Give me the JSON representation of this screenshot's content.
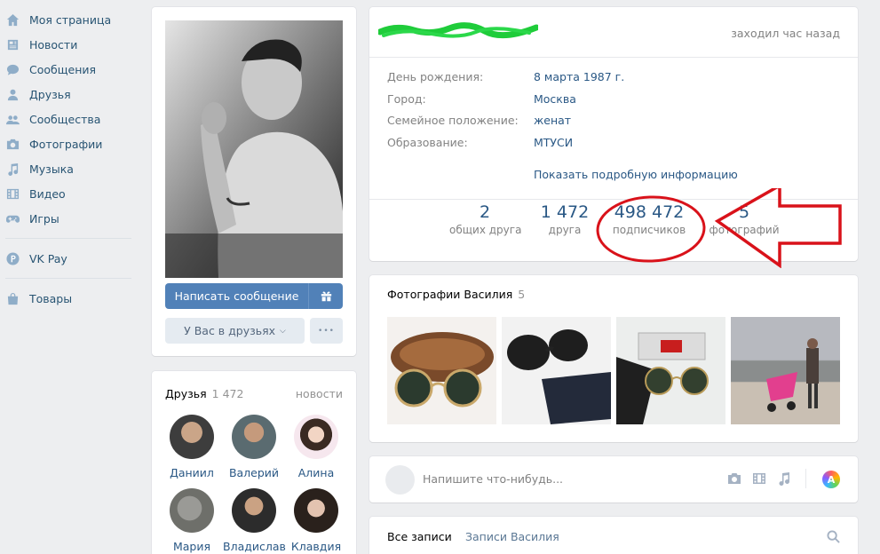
{
  "nav": {
    "items": [
      {
        "label": "Моя страница",
        "icon": "home-icon"
      },
      {
        "label": "Новости",
        "icon": "news-icon"
      },
      {
        "label": "Сообщения",
        "icon": "messages-icon"
      },
      {
        "label": "Друзья",
        "icon": "friends-icon"
      },
      {
        "label": "Сообщества",
        "icon": "communities-icon"
      },
      {
        "label": "Фотографии",
        "icon": "camera-icon"
      },
      {
        "label": "Музыка",
        "icon": "music-icon"
      },
      {
        "label": "Видео",
        "icon": "video-icon"
      },
      {
        "label": "Игры",
        "icon": "games-icon"
      }
    ],
    "vkpay": {
      "label": "VK Pay",
      "icon": "vkpay-icon"
    },
    "goods": {
      "label": "Товары",
      "icon": "bag-icon"
    }
  },
  "profile": {
    "write_message": "Написать сообщение",
    "in_friends": "У Вас в друзьях",
    "more": "•••",
    "online": "заходил час назад"
  },
  "info": {
    "rows": [
      {
        "key": "День рождения:",
        "value": "8 марта 1987 г."
      },
      {
        "key": "Город:",
        "value": "Москва"
      },
      {
        "key": "Семейное положение:",
        "value": "женат"
      },
      {
        "key": "Образование:",
        "value": "МТУСИ"
      }
    ],
    "show_more": "Показать подробную информацию"
  },
  "counters": [
    {
      "num": "2",
      "label": "общих друга"
    },
    {
      "num": "1 472",
      "label": "друга"
    },
    {
      "num": "498 472",
      "label": "подписчиков"
    },
    {
      "num": "5",
      "label": "фотографий"
    }
  ],
  "friends": {
    "title": "Друзья",
    "count": "1 472",
    "news": "новости",
    "list": [
      {
        "name": "Даниил"
      },
      {
        "name": "Валерий"
      },
      {
        "name": "Алина"
      },
      {
        "name": "Мария"
      },
      {
        "name": "Владислав"
      },
      {
        "name": "Клавдия"
      }
    ]
  },
  "photos": {
    "title": "Фотографии Василия",
    "count": "5"
  },
  "post": {
    "placeholder": "Напишите что-нибудь..."
  },
  "wall": {
    "all_posts": "Все записи",
    "user_posts": "Записи Василия"
  },
  "colors": {
    "link": "#2a5885",
    "accent": "#5181b8",
    "annotation": "#d9121a",
    "scribble": "#1fcc3a"
  }
}
